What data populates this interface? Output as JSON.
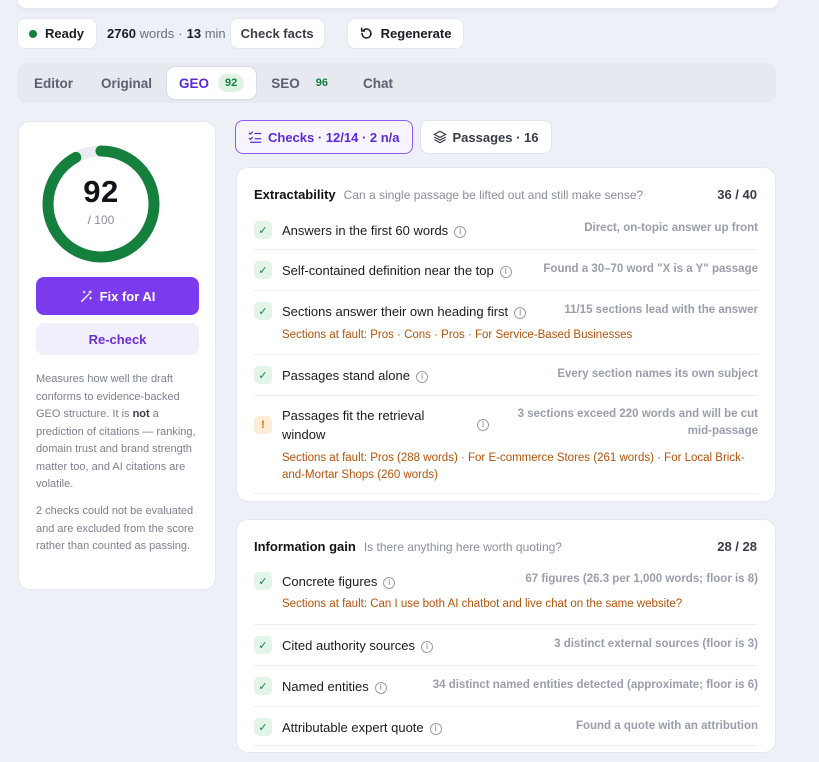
{
  "toolbar": {
    "status": "Ready",
    "word_count": "2760",
    "words_label": "words",
    "separator": "·",
    "minutes": "13",
    "min_label": "min",
    "check_facts": "Check facts",
    "regenerate": "Regenerate"
  },
  "tabs": [
    {
      "label": "Editor"
    },
    {
      "label": "Original"
    },
    {
      "label": "GEO",
      "badge": "92"
    },
    {
      "label": "SEO",
      "badge": "96"
    },
    {
      "label": "Chat"
    }
  ],
  "score": {
    "value": "92",
    "max_label": "/ 100",
    "progress": 0.92,
    "fix_button": "Fix for AI",
    "recheck_button": "Re-check",
    "note1_a": "Measures how well the draft conforms to evidence-backed GEO structure. It is ",
    "note1_b": "not",
    "note1_c": " a prediction of citations — ranking, domain trust and brand strength matter too, and AI citations are volatile.",
    "note2": "2 checks could not be evaluated and are excluded from the score rather than counted as passing."
  },
  "subtabs": {
    "checks": "Checks · 12/14 · 2 n/a",
    "passages": "Passages · 16"
  },
  "sections": [
    {
      "title": "Extractability",
      "subtitle": "Can a single passage be lifted out and still make sense?",
      "score": "36 / 40",
      "checks": [
        {
          "status": "pass",
          "label": "Answers in the first 60 words",
          "detail": "Direct, on-topic answer up front"
        },
        {
          "status": "pass",
          "label": "Self-contained definition near the top",
          "detail": "Found a 30–70 word \"X is a Y\" passage"
        },
        {
          "status": "pass",
          "label": "Sections answer their own heading first",
          "detail": "11/15 sections lead with the answer",
          "fault": "Sections at fault: Pros · Cons · Pros · For Service-Based Businesses"
        },
        {
          "status": "pass",
          "label": "Passages stand alone",
          "detail": "Every section names its own subject"
        },
        {
          "status": "warn",
          "label": "Passages fit the retrieval window",
          "detail": "3 sections exceed 220 words and will be cut mid-passage",
          "fault": "Sections at fault: Pros (288 words) · For E-commerce Stores (261 words) · For Local Brick-and-Mortar Shops (260 words)"
        }
      ]
    },
    {
      "title": "Information gain",
      "subtitle": "Is there anything here worth quoting?",
      "score": "28 / 28",
      "checks": [
        {
          "status": "pass",
          "label": "Concrete figures",
          "detail": "67 figures (26.3 per 1,000 words; floor is 8)",
          "fault": "Sections at fault: Can I use both AI chatbot and live chat on the same website?"
        },
        {
          "status": "pass",
          "label": "Cited authority sources",
          "detail": "3 distinct external sources (floor is 3)"
        },
        {
          "status": "pass",
          "label": "Named entities",
          "detail": "34 distinct named entities detected (approximate; floor is 6)"
        },
        {
          "status": "pass",
          "label": "Attributable expert quote",
          "detail": "Found a quote with an attribution"
        }
      ]
    }
  ],
  "colors": {
    "accent": "#7c3aed",
    "pass": "#15803d",
    "warn": "#d97706",
    "fault": "#b45309"
  },
  "icons": {
    "pass": "check-icon",
    "warn": "exclamation-icon",
    "info": "info-icon"
  }
}
